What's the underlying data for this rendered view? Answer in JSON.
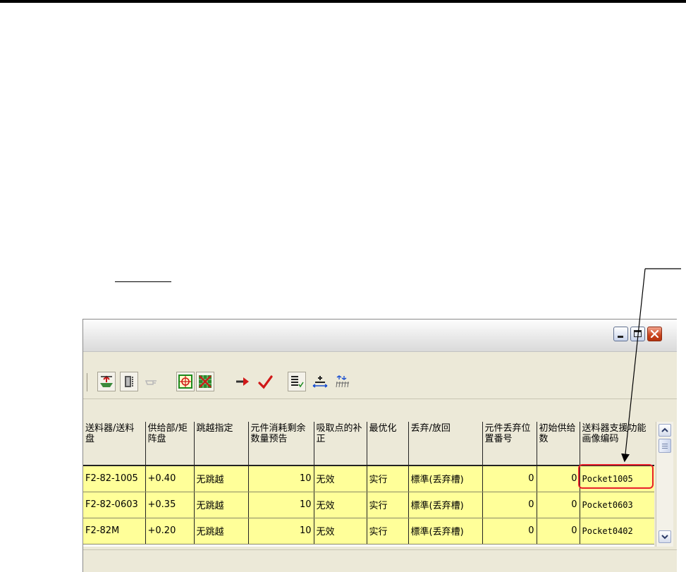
{
  "colors": {
    "row_fill": "#ffff99",
    "highlight": "#e8202a",
    "window_bg": "#ece9d8"
  },
  "window": {
    "buttons": [
      "minimize-icon",
      "maximize-icon",
      "close-icon"
    ]
  },
  "toolbar": {
    "icons": [
      "feeder-up-icon",
      "strip-icon",
      "hand-pointer-icon",
      "target-icon",
      "grid-cancel-icon",
      "arrow-right-icon",
      "checkmark-icon",
      "list-check-icon",
      "align-icon",
      "pitch-icon"
    ]
  },
  "grid": {
    "headers": [
      "送料器/送料盘",
      "供给部/矩阵盘",
      "跳越指定",
      "元件消耗剩余数量预告",
      "吸取点的补正",
      "最优化",
      "丢弃/放回",
      "元件丢弃位置番号",
      "初始供给数",
      "送料器支援功能画像编码"
    ],
    "rows": [
      [
        "F2-82-1005",
        "+0.40",
        "无跳越",
        "10",
        "无效",
        "实行",
        "標準(丢弃槽)",
        "0",
        "0",
        "Pocket1005"
      ],
      [
        "F2-82-0603",
        "+0.35",
        "无跳越",
        "10",
        "无效",
        "实行",
        "標準(丢弃槽)",
        "0",
        "0",
        "Pocket0603"
      ],
      [
        "F2-82M",
        "+0.20",
        "无跳越",
        "10",
        "无效",
        "实行",
        "標準(丢弃槽)",
        "0",
        "0",
        "Pocket0402"
      ]
    ]
  }
}
